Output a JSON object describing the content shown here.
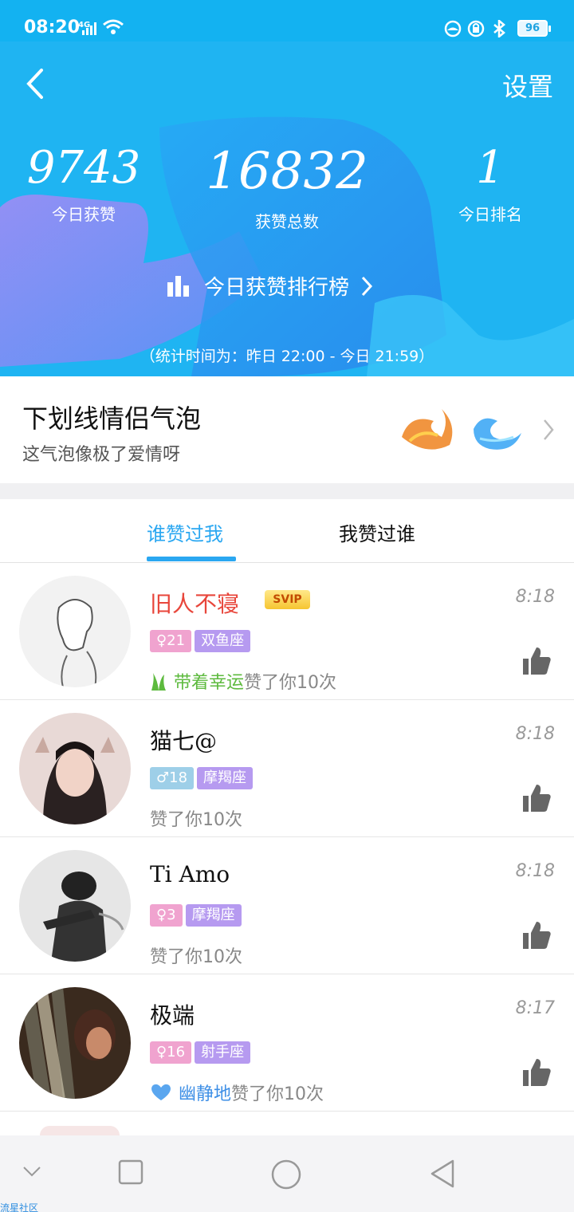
{
  "status_bar": {
    "time": "08:20",
    "network": "4G",
    "battery": "96"
  },
  "header": {
    "settings_label": "设置",
    "stats": [
      {
        "value": "9743",
        "label": "今日获赞"
      },
      {
        "value": "16832",
        "label": "获赞总数"
      },
      {
        "value": "1",
        "label": "今日排名"
      }
    ],
    "rank_link": "今日获赞排行榜",
    "stat_period": "（统计时间为：昨日 22:00 - 今日 21:59）"
  },
  "bubble_promo": {
    "title": "下划线情侣气泡",
    "subtitle": "这气泡像极了爱情呀"
  },
  "tabs": [
    {
      "label": "谁赞过我",
      "active": true
    },
    {
      "label": "我赞过谁",
      "active": false
    }
  ],
  "list": [
    {
      "name": "旧人不寝",
      "badge": "SVIP",
      "gender_tag": "♀21",
      "zodiac": "双鱼座",
      "liked_prefix": "带着幸运",
      "liked_text": "赞了你10次",
      "time": "8:18"
    },
    {
      "name": "猫七@",
      "gender_tag": "♂18",
      "zodiac": "摩羯座",
      "liked_text": "赞了你10次",
      "time": "8:18"
    },
    {
      "name": "Ti Amo",
      "gender_tag": "♀3",
      "zodiac": "摩羯座",
      "liked_text": "赞了你10次",
      "time": "8:18"
    },
    {
      "name": "极端",
      "gender_tag": "♀16",
      "zodiac": "射手座",
      "liked_prefix": "幽静地",
      "liked_text": "赞了你10次",
      "time": "8:17"
    }
  ],
  "watermark": "流星社区",
  "colors": {
    "header_bg": "#1fb4f2",
    "accent": "#2aa7f1",
    "female_tag": "#f0a3cf",
    "male_tag": "#9ecfe8",
    "zodiac_tag": "#b69af0"
  }
}
